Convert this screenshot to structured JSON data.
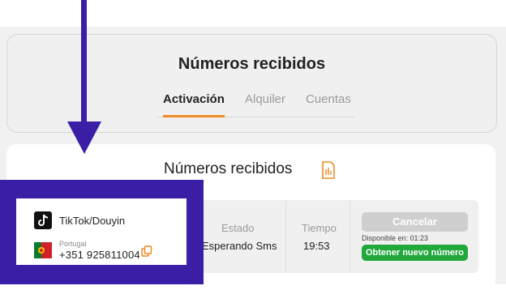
{
  "header": {
    "title": "Números recibidos",
    "tabs": [
      {
        "label": "Activación",
        "active": true
      },
      {
        "label": "Alquiler",
        "active": false
      },
      {
        "label": "Cuentas",
        "active": false
      }
    ]
  },
  "section": {
    "title": "Números recibidos",
    "icon": "document-icon"
  },
  "row": {
    "service": "TikTok/Douyin",
    "service_icon": "tiktok-icon",
    "country": "Portugal",
    "country_icon": "portugal-flag-icon",
    "phone": "+351 925811004",
    "status_header": "Estado",
    "status_value": "Esperando Sms",
    "time_header": "Tiempo",
    "time_value": "19:53",
    "cancel_label": "Cancelar",
    "available_text": "Disponible en: 01:23",
    "new_number_label": "Obtener nuevo número"
  },
  "colors": {
    "accent": "#f08a24",
    "highlight": "#3a1ea6",
    "success": "#22a83c",
    "disabled": "#cfcfcf"
  }
}
